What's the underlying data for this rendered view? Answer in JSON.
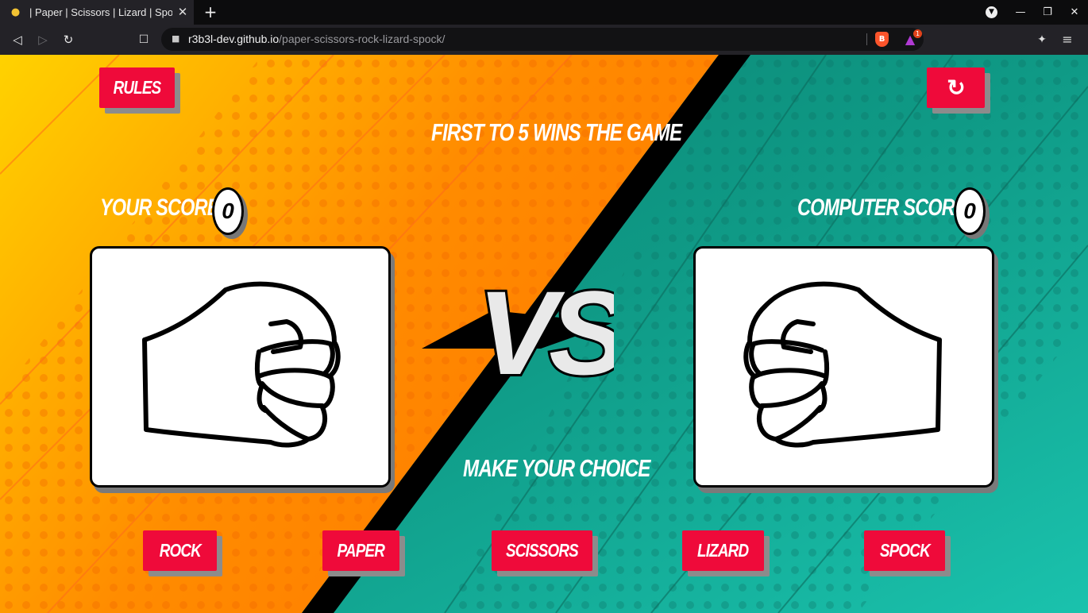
{
  "browser": {
    "tab_title": "| Paper | Scissors | Lizard | Spock",
    "tab_favicon": "fist-emoji-icon",
    "url_host": "r3b3l-dev.github.io",
    "url_path": "/paper-scissors-rock-lizard-spock/",
    "rewards_badge": "1"
  },
  "game": {
    "rules_label": "RULES",
    "restart_glyph": "↻",
    "headline": "FIRST TO 5 WINS THE GAME",
    "player_score_label": "YOUR SCORE:",
    "player_score": "0",
    "computer_score_label": "COMPUTER SCORE:",
    "computer_score": "0",
    "vs_label": "VS",
    "player_hand": "rock-fist",
    "computer_hand": "rock-fist",
    "prompt": "MAKE YOUR CHOICE",
    "choices": [
      "ROCK",
      "PAPER",
      "SCISSORS",
      "LIZARD",
      "SPOCK"
    ]
  },
  "colors": {
    "button_red": "#ef0a3a",
    "left_orange": "#ff8c00",
    "left_yellow": "#ffd200",
    "right_teal": "#12a896"
  }
}
